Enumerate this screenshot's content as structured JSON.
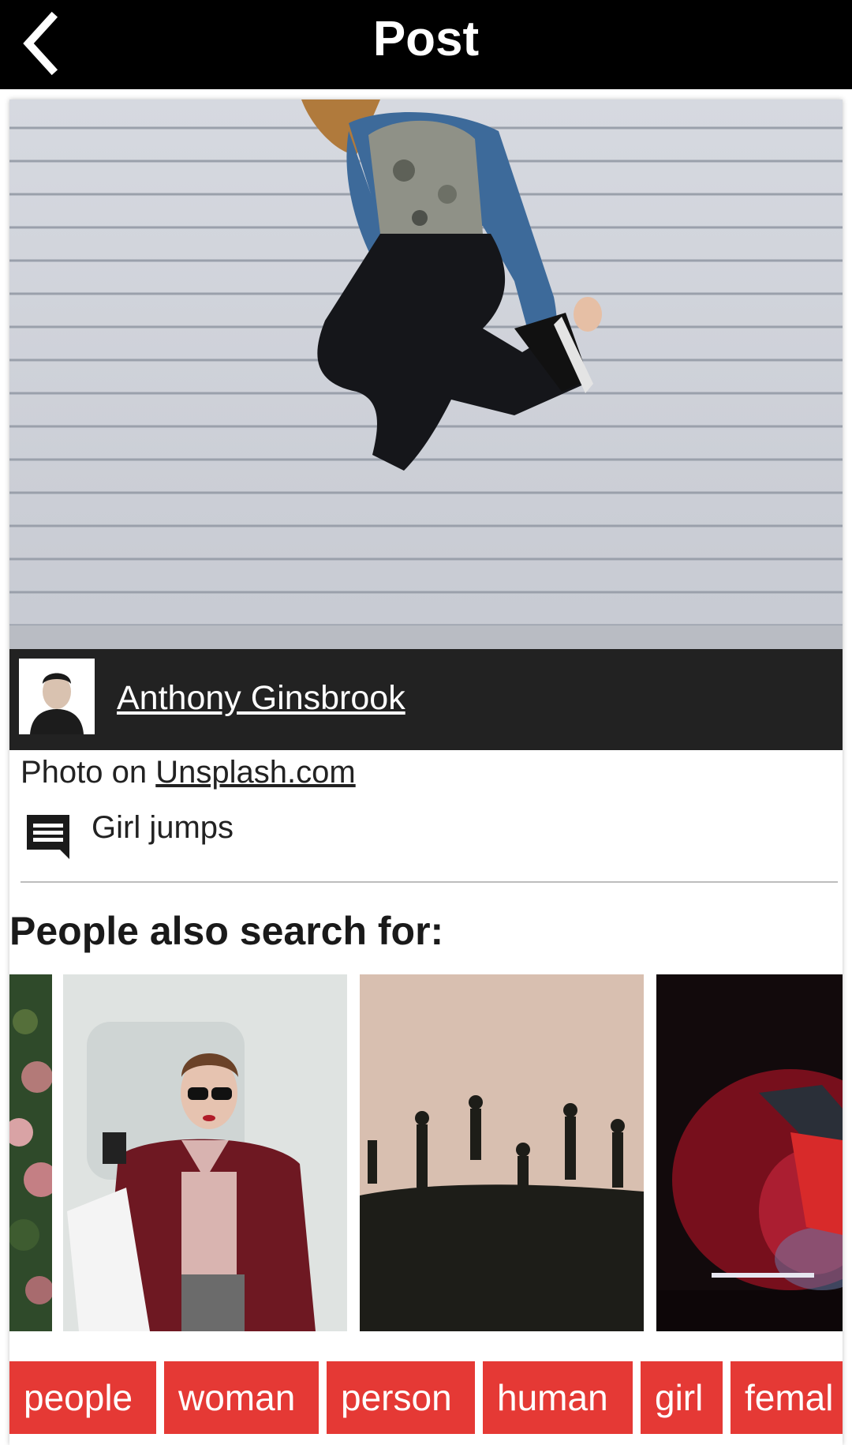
{
  "appbar": {
    "title": "Post",
    "back_icon": "chevron-left-icon"
  },
  "post": {
    "author_name": "Anthony Ginsbrook",
    "source_prefix": "Photo on ",
    "source_link": "Unsplash.com",
    "caption": "Girl jumps",
    "comment_icon": "comment-icon"
  },
  "related": {
    "title": "People also search for:",
    "thumbnails": [
      "flowers",
      "woman-shopping",
      "jumping-silhouettes",
      "breakdancer"
    ]
  },
  "tags": [
    "people",
    "woman",
    "person",
    "human",
    "girl",
    "femal"
  ],
  "colors": {
    "appbar": "#000000",
    "author_bar": "#222222",
    "tag_bg": "#e53935",
    "tag_text": "#ffffff"
  }
}
